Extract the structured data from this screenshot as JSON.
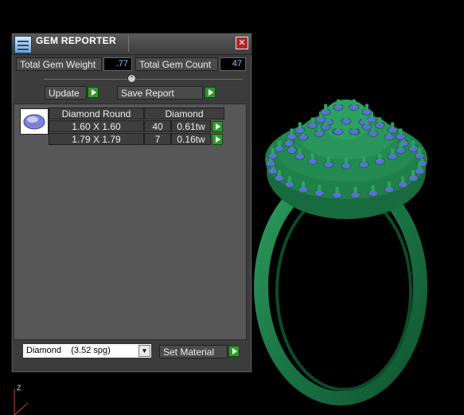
{
  "panel": {
    "title": "GEM REPORTER",
    "total_gem_weight_label": "Total Gem Weight",
    "total_gem_weight_value": ".77",
    "total_gem_count_label": "Total Gem Count",
    "total_gem_count_value": "47",
    "update_label": "Update",
    "save_report_label": "Save Report",
    "table": {
      "headers": [
        "Diamond Round",
        "Diamond"
      ],
      "rows": [
        {
          "size": "1.60 X 1.60",
          "count": "40",
          "weight": "0.61tw"
        },
        {
          "size": "1.79 X 1.79",
          "count": "7",
          "weight": "0.16tw"
        }
      ]
    },
    "material_select": "Diamond    (3.52 spg)",
    "set_material_label": "Set Material"
  },
  "viewport": {
    "axis_label": "Z",
    "ring_color": "#1e7a4a",
    "gem_color": "#5a6fd8"
  }
}
